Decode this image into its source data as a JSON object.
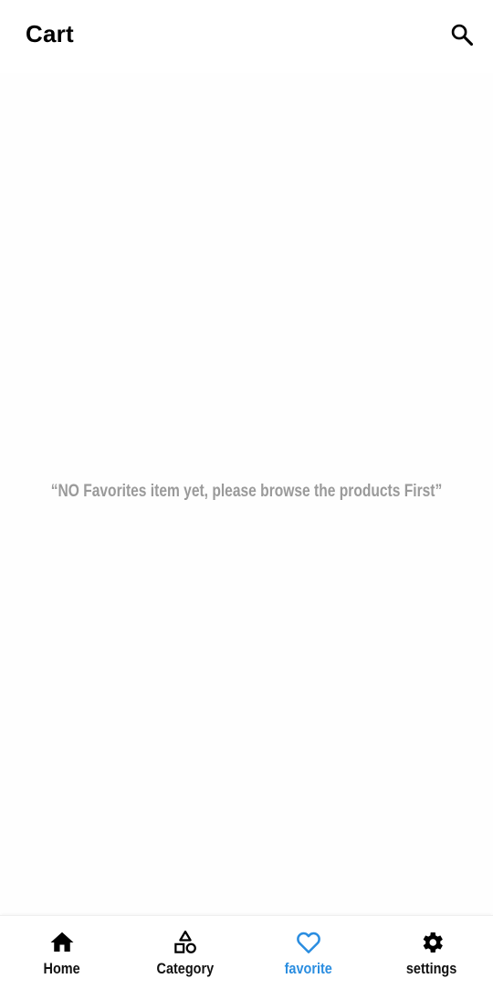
{
  "header": {
    "title": "Cart",
    "search_icon": "search-icon"
  },
  "main": {
    "empty_message": "“NO Favorites item yet, please browse the products First”"
  },
  "bottom_nav": {
    "active_color": "#2a8de0",
    "items": [
      {
        "label": "Home",
        "icon": "home-icon"
      },
      {
        "label": "Category",
        "icon": "shapes-icon"
      },
      {
        "label": "favorite",
        "icon": "heart-icon",
        "active": true
      },
      {
        "label": "settings",
        "icon": "gear-icon"
      }
    ]
  }
}
